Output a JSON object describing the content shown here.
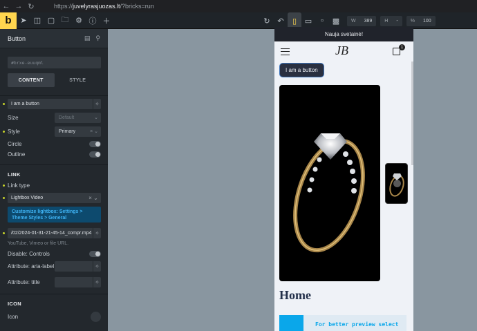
{
  "browser": {
    "url_prefix": "https://",
    "url_host": "juvelyrasjuozas.lt",
    "url_path": "/?bricks=run"
  },
  "toolbar": {
    "logo": "b",
    "width_label": "W",
    "width_value": "389",
    "height_label": "H",
    "height_value": "-",
    "zoom_label": "%",
    "zoom_value": "100"
  },
  "panel": {
    "title": "Button",
    "element_id": "#brxe-euuqml",
    "tabs": [
      "CONTENT",
      "STYLE"
    ],
    "text_value": "I am a button",
    "size_label": "Size",
    "size_placeholder": "Default",
    "style_label": "Style",
    "style_value": "Primary",
    "circle_label": "Circle",
    "outline_label": "Outline",
    "link_section": "LINK",
    "link_type_label": "Link type",
    "link_type_value": "Lightbox Video",
    "lightbox_note": "Customize lightbox: Settings > Theme Styles > General",
    "video_url": "/02/2024-01-31-21-45-14_compr.mp4",
    "video_hint": "YouTube, Vimeo or file URL.",
    "controls_label": "Disable: Controls",
    "aria_label": "Attribute: aria-label",
    "title_attr_label": "Attribute: title",
    "icon_section": "ICON",
    "icon_label": "Icon"
  },
  "preview": {
    "promo": "Nauja svetainė!",
    "brand": "JB",
    "cart_count": "1",
    "button_text": "I am a button",
    "heading": "Home",
    "notice": "For better preview select"
  },
  "colors": {
    "accent": "#ffd64f",
    "link_note_bg": "#0d4a6e",
    "link_note_text": "#3fb4f5",
    "button_bg": "#2a3040",
    "notice": "#0aa7ea"
  }
}
